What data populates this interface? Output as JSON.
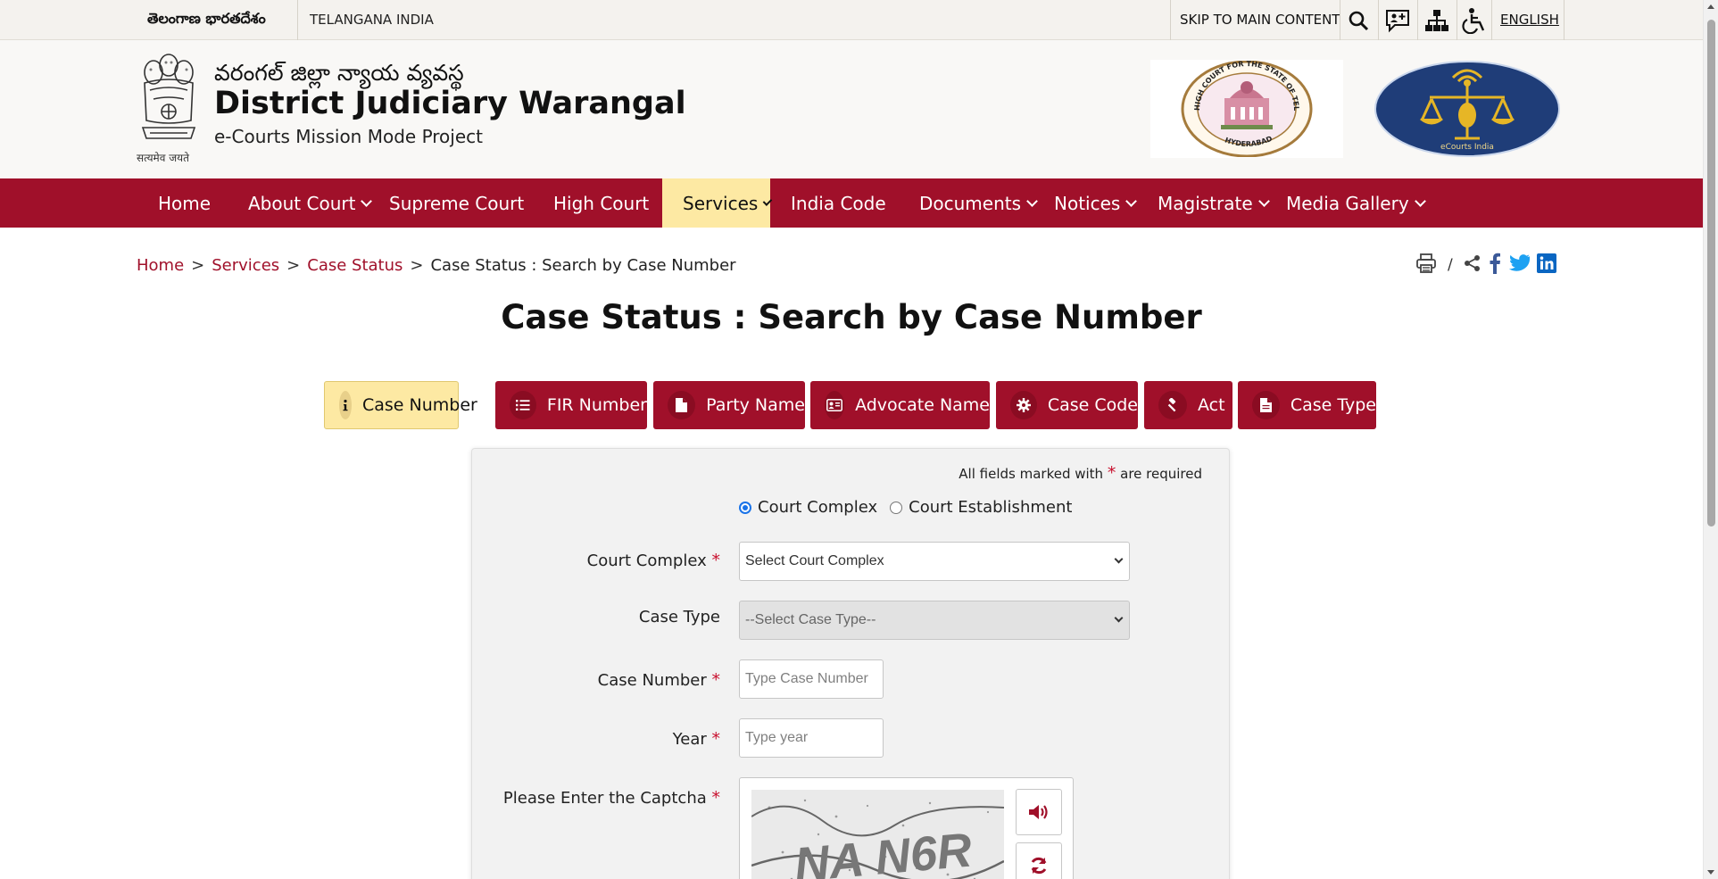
{
  "topbar": {
    "telugu_label": "తెలంగాణ భారతదేశం",
    "country": "TELANGANA INDIA",
    "skip_link": "SKIP TO MAIN CONTENT",
    "language": "ENGLISH",
    "icons": [
      "search-icon",
      "feedback-icon",
      "sitemap-icon",
      "accessibility-icon"
    ]
  },
  "header": {
    "emblem_motto": "सत्यमेव जयते",
    "telugu_title": "వరంగల్ జిల్లా న్యాయ వ్యవస్థ",
    "title": "District Judiciary Warangal",
    "subtitle": "e-Courts Mission Mode Project",
    "hc_seal_text": "HIGH COURT FOR THE STATE OF TELANGANA",
    "hc_seal_bottom": "HYDERABAD",
    "ecourts_logo_text": "eCourts India"
  },
  "nav": {
    "items": [
      {
        "label": "Home"
      },
      {
        "label": "About Court"
      },
      {
        "label": "Supreme Court"
      },
      {
        "label": "High Court"
      },
      {
        "label": "Services"
      },
      {
        "label": "India Code"
      },
      {
        "label": "Documents"
      },
      {
        "label": "Notices"
      },
      {
        "label": "Magistrate"
      },
      {
        "label": "Media Gallery"
      }
    ]
  },
  "breadcrumb": {
    "items": [
      "Home",
      "Services",
      "Case Status"
    ],
    "current": "Case Status : Search by Case Number",
    "separator": ">",
    "share_divider": "/"
  },
  "page": {
    "title": "Case Status : Search by Case Number"
  },
  "tabs": [
    {
      "label": "Case Number",
      "icon": "info-icon"
    },
    {
      "label": "FIR Number",
      "icon": "list-icon"
    },
    {
      "label": "Party Name",
      "icon": "document-icon"
    },
    {
      "label": "Advocate Name",
      "icon": "id-card-icon"
    },
    {
      "label": "Case Code",
      "icon": "gear-icon"
    },
    {
      "label": "Act",
      "icon": "gavel-icon"
    },
    {
      "label": "Case Type",
      "icon": "document-icon"
    }
  ],
  "form": {
    "required_note_pre": "All fields marked with",
    "required_note_post": "are required",
    "required_mark": "*",
    "radio_options": [
      "Court Complex",
      "Court Establishment"
    ],
    "selected_radio": "Court Complex",
    "court_complex_label": "Court Complex",
    "court_complex_value": "Select Court Complex",
    "case_type_label": "Case Type",
    "case_type_value": "--Select Case Type--",
    "case_number_label": "Case Number",
    "case_number_placeholder": "Type Case Number",
    "year_label": "Year",
    "year_placeholder": "Type year",
    "captcha_label": "Please Enter the Captcha",
    "captcha_text": "NA N6R"
  },
  "colors": {
    "brand_maroon": "#a0102a",
    "active_yellow": "#fde9a3",
    "required_red": "#c8102e",
    "facebook": "#3b5998",
    "twitter": "#1da1f2",
    "linkedin": "#0a66c2"
  }
}
